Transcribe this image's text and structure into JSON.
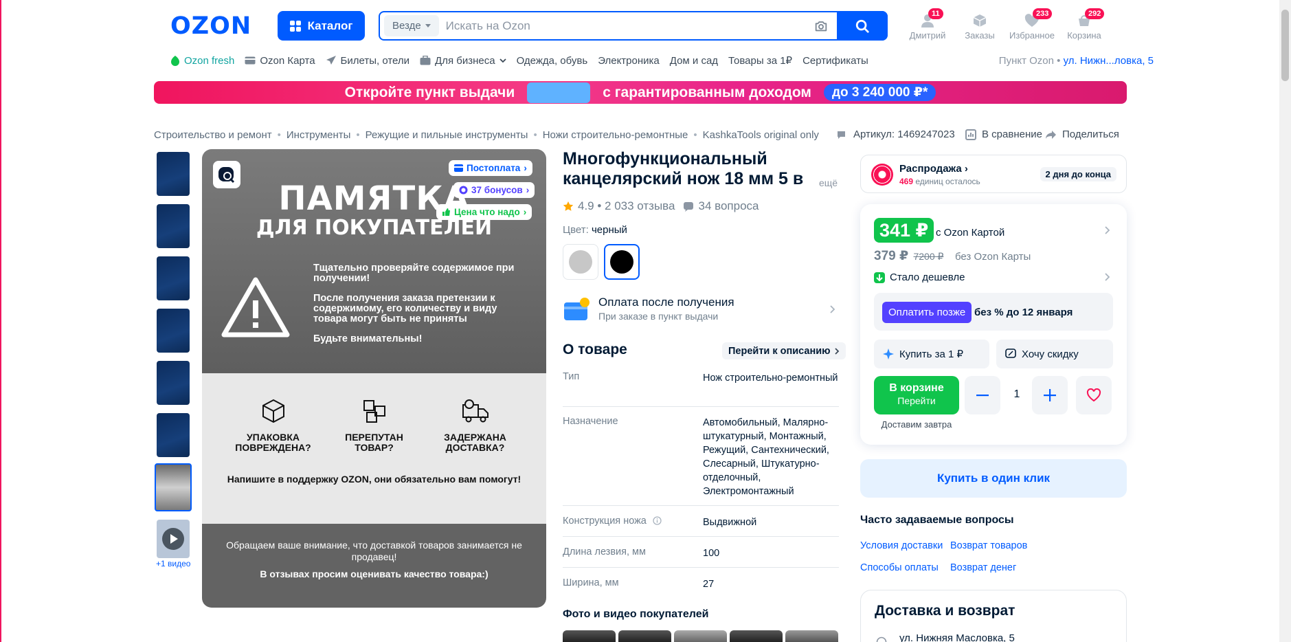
{
  "header": {
    "logo": "OZON",
    "catalog_label": "Каталог",
    "search_scope": "Везде",
    "search_placeholder": "Искать на Ozon",
    "user": {
      "label": "Дмитрий",
      "badge": "11"
    },
    "orders": {
      "label": "Заказы"
    },
    "favorites": {
      "label": "Избранное",
      "badge": "233"
    },
    "cart": {
      "label": "Корзина",
      "badge": "292"
    }
  },
  "nav": {
    "items": [
      "Ozon fresh",
      "Ozon Карта",
      "Билеты, отели",
      "Для бизнеса",
      "Одежда, обувь",
      "Электроника",
      "Дом и сад",
      "Товары за 1₽",
      "Сертификаты"
    ],
    "pickup_label": "Пункт Ozon •",
    "pickup_address": "ул. Нижн...ловка, 5"
  },
  "banner": {
    "left_text": "Откройте пункт выдачи",
    "mid_text": "с гарантированным доходом",
    "pill_text": "до 3 240 000 ₽*"
  },
  "breadcrumbs": [
    "Строительство и ремонт",
    "Инструменты",
    "Режущие и пильные инструменты",
    "Ножи строительно-ремонтные",
    "KashkaTools original only"
  ],
  "meta": {
    "article": "Артикул: 1469247023",
    "compare": "В сравнение",
    "share": "Поделиться"
  },
  "gallery": {
    "video_label": "+1 видео",
    "tags": [
      "Постоплата",
      "37 бонусов",
      "Цена что надо"
    ],
    "image": {
      "title1": "ПАМЯТКА",
      "title2": "ДЛЯ ПОКУПАТЕЛЕЙ",
      "p1": "Тщательно проверяйте содержимое при получении!",
      "p2": "После получения заказа претензии к содержимому, его количеству и виду товара могут быть не приняты",
      "p3": "Будьте внимательны!",
      "icon1": "УПАКОВКА ПОВРЕЖДЕНА?",
      "icon2": "ПЕРЕПУТАН ТОВАР?",
      "icon3": "ЗАДЕРЖАНА ДОСТАВКА?",
      "support": "Напишите в поддержку OZON, они обязательно вам помогут!",
      "bottom1": "Обращаем ваше внимание, что доставкой товаров занимается не продавец!",
      "bottom2": "В отзывах просим оценивать качество товара:)"
    }
  },
  "product": {
    "title": "Многофункциональный канцелярский нож 18 мм 5 в 1",
    "title_more": "ещё",
    "rating": "4.9 • 2 033 отзыва",
    "questions": "34 вопроса",
    "color_label": "Цвет:",
    "color_value": "черный",
    "swatches": [
      "#c7c7c7",
      "#000000"
    ],
    "pay_after_title": "Оплата после получения",
    "pay_after_sub": "При заказе в пункт выдачи",
    "about_title": "О товаре",
    "goto_desc": "Перейти к описанию",
    "specs": [
      {
        "k": "Тип",
        "v": "Нож строительно-ремонтный"
      },
      {
        "k": "Назначение",
        "v": "Автомобильный, Малярно-штукатурный, Монтажный, Режущий, Сантехнический, Слесарный, Штукатурно-отделочный, Электромонтажный"
      },
      {
        "k": "Конструкция ножа",
        "v": "Выдвижной"
      },
      {
        "k": "Длина лезвия, мм",
        "v": "100"
      },
      {
        "k": "Ширина, мм",
        "v": "27"
      }
    ],
    "photos_title": "Фото и видео покупателей"
  },
  "sale": {
    "title": "Распродажа",
    "left_count": "469",
    "left_text": "единиц осталось",
    "days": "2 дня до конца"
  },
  "buybox": {
    "price_card": "341 ₽",
    "price_card_label": "с Ozon Картой",
    "price": "379 ₽",
    "price_old": "7200 ₽",
    "price_no_card": "без Ozon Карты",
    "cheaper": "Стало дешевле",
    "pay_later_btn": "Оплатить позже",
    "pay_later_text": "без % до 12 января",
    "buy_for_1": "Купить за 1 ₽",
    "want_discount": "Хочу скидку",
    "in_cart": "В корзине",
    "go": "Перейти",
    "qty": "1",
    "delivery": "Доставим завтра"
  },
  "oneclick": "Купить в один клик",
  "faq": {
    "title": "Часто задаваемые вопросы",
    "links": [
      "Условия доставки",
      "Возврат товаров",
      "Способы оплаты",
      "Возврат денег"
    ]
  },
  "delivery_box": {
    "title": "Доставка и возврат",
    "address": "ул. Нижняя Масловка, 5"
  },
  "colors": {
    "accent": "#005bff",
    "green": "#10c44c",
    "pink": "#f91155",
    "purple": "#5341ff"
  }
}
